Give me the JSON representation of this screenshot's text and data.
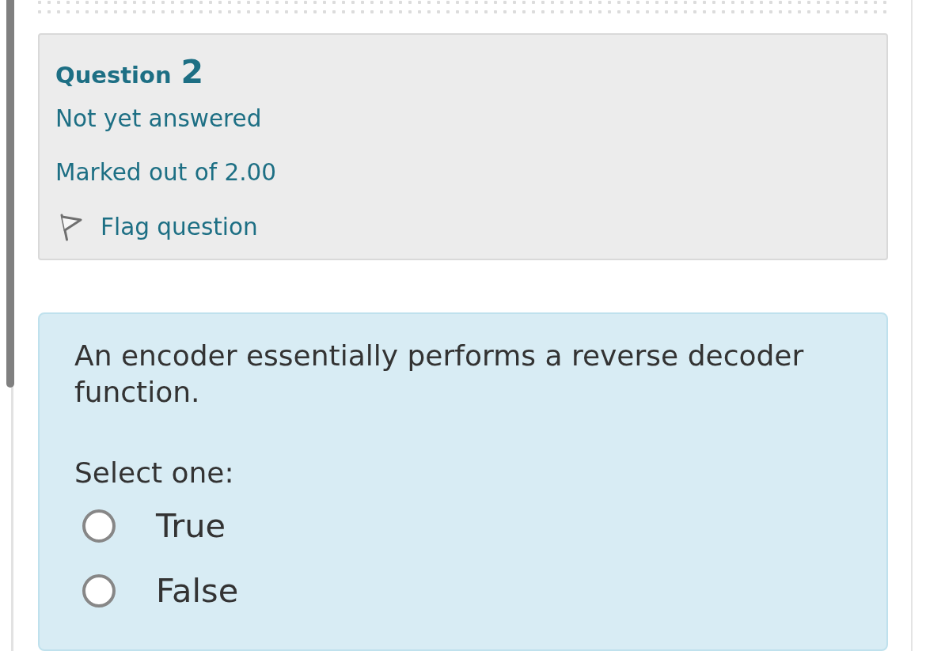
{
  "question_info": {
    "label": "Question",
    "number": "2",
    "status": "Not yet answered",
    "grade": "Marked out of 2.00",
    "flag": {
      "label": "Flag question",
      "flagged": false
    }
  },
  "question": {
    "text": "An encoder essentially performs a reverse decoder function.",
    "prompt": "Select one:",
    "options": [
      {
        "label": "True",
        "selected": false
      },
      {
        "label": "False",
        "selected": false
      }
    ]
  }
}
